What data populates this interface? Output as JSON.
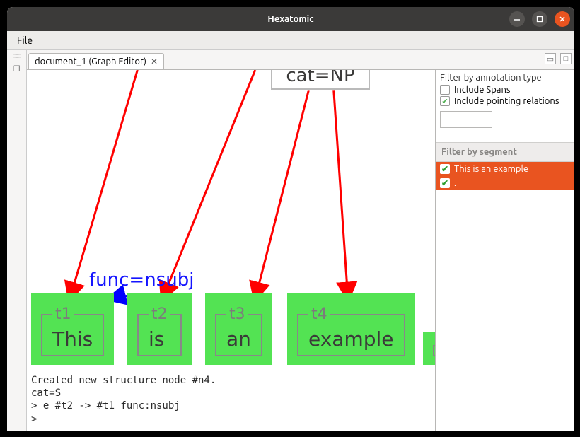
{
  "window": {
    "title": "Hexatomic"
  },
  "menubar": {
    "file": "File"
  },
  "tab": {
    "label": "document_1 (Graph Editor)"
  },
  "graph": {
    "cat_node": "cat=NP",
    "edge_label": "func=nsubj",
    "tokens": [
      {
        "id": "t1",
        "text": "This"
      },
      {
        "id": "t2",
        "text": "is"
      },
      {
        "id": "t3",
        "text": "an"
      },
      {
        "id": "t4",
        "text": "example"
      }
    ]
  },
  "console": {
    "lines": "Created new structure node #n4.\ncat=S\n> e #t2 -> #t1 func:nsubj\n> "
  },
  "sidebar": {
    "filter_type_title": "Filter by annotation type",
    "include_spans": "Include Spans",
    "include_pointing": "Include pointing relations",
    "filter_segment_title": "Filter by segment",
    "segments": [
      {
        "label": "This is an example"
      },
      {
        "label": "."
      }
    ]
  }
}
